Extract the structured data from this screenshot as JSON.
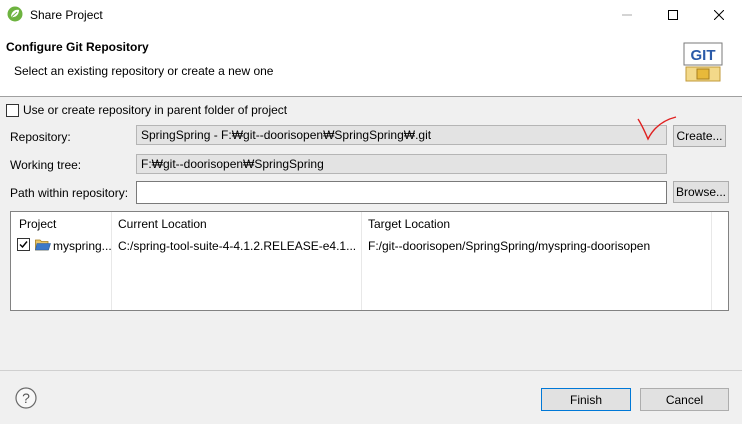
{
  "window": {
    "title": "Share Project",
    "minimize_icon": "minimize-icon",
    "maximize_icon": "maximize-icon",
    "close_icon": "close-icon"
  },
  "header": {
    "title": "Configure Git Repository",
    "subtitle": "Select an existing repository or create a new one",
    "logo_text": "GIT"
  },
  "form": {
    "parent_folder_label": "Use or create repository in parent folder of project",
    "parent_folder_checked": false,
    "repository_label": "Repository:",
    "repository_value": "SpringSpring - F:₩git--doorisopen₩SpringSpring₩.git",
    "create_button": "Create...",
    "working_tree_label": "Working tree:",
    "working_tree_value": "F:₩git--doorisopen₩SpringSpring",
    "path_label": "Path within repository:",
    "path_value": "",
    "browse_button": "Browse..."
  },
  "table": {
    "columns": [
      "Project",
      "Current Location",
      "Target Location"
    ],
    "rows": [
      {
        "checked": true,
        "project": "myspring...",
        "current_location": "C:/spring-tool-suite-4-4.1.2.RELEASE-e4.1...",
        "target_location": "F:/git--doorisopen/SpringSpring/myspring-doorisopen"
      }
    ]
  },
  "footer": {
    "help_icon": "help-icon",
    "finish_button": "Finish",
    "cancel_button": "Cancel"
  },
  "colors": {
    "annotation_mark": "#e02020",
    "finish_border": "#0078d7"
  }
}
